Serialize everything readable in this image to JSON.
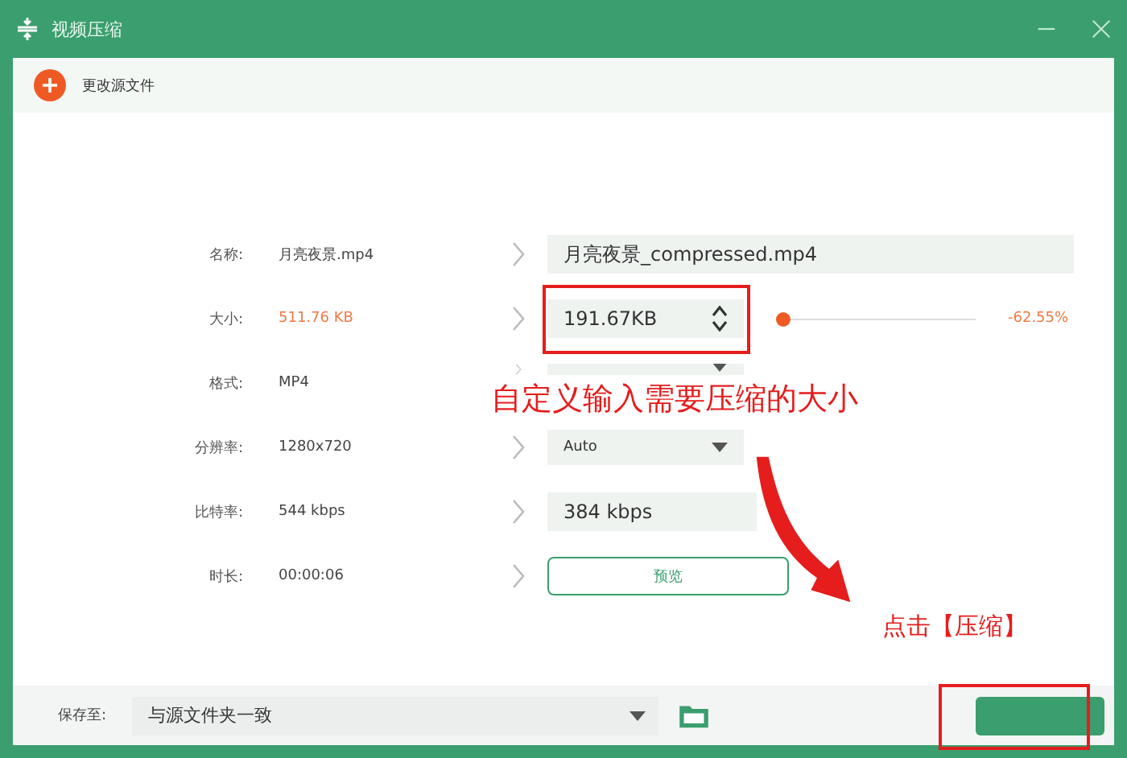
{
  "window": {
    "title": "视频压缩"
  },
  "toolbar": {
    "change_source": "更改源文件"
  },
  "rows": [
    {
      "kind": "text",
      "label": "名称:",
      "original": "月亮夜景.mp4",
      "target": "月亮夜景_compressed.mp4"
    },
    {
      "kind": "size",
      "label": "大小:",
      "original": "511.76 KB",
      "target": "191.67KB",
      "level": 0.0,
      "reading": "-62.55%"
    },
    {
      "kind": "dropdown",
      "label": "格式:",
      "original": "MP4"
    },
    {
      "kind": "dropdown",
      "label": "分辨率:",
      "original": "1280x720",
      "target": "Auto"
    },
    {
      "kind": "text",
      "label": "比特率:",
      "original": "544 kbps",
      "target": "384 kbps"
    },
    {
      "kind": "button",
      "label": "时长:",
      "original": "00:00:06",
      "target": "预览"
    }
  ],
  "save_bar": {
    "label": "保存至:",
    "value": "与源文件夹一致"
  },
  "annotations": [
    {
      "kind": "note",
      "text": "自定义输入需要压缩的大小"
    },
    {
      "kind": "note",
      "text": "点击【压缩】"
    }
  ]
}
